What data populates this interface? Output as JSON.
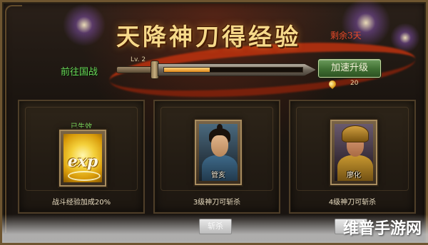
{
  "header": {
    "title": "天降神刀得经验",
    "days_left": "剩余3天"
  },
  "progress": {
    "goto_label": "前往国战",
    "level_label": "Lv. 2",
    "fraction": 0.33,
    "speed_button": "加速升级",
    "cost_value": "20",
    "cost_icon": "gold-ingot-icon"
  },
  "cards": [
    {
      "status": "已生效",
      "icon_text": "exp",
      "caption": "战斗经验加成20%"
    },
    {
      "hero_name": "管亥",
      "caption": "3级神刀可斩杀"
    },
    {
      "hero_name": "廖化",
      "caption": "4级神刀可斩杀"
    }
  ],
  "buttons": {
    "slash_left": "斩杀",
    "slash_right": "斩杀"
  },
  "watermark": "维普手游网",
  "colors": {
    "title_gold": "#f6d98a",
    "active_green": "#7fe060",
    "goto_green": "#6cd65a",
    "days_red": "#e84a2a",
    "button_green": "#3f6e32"
  }
}
